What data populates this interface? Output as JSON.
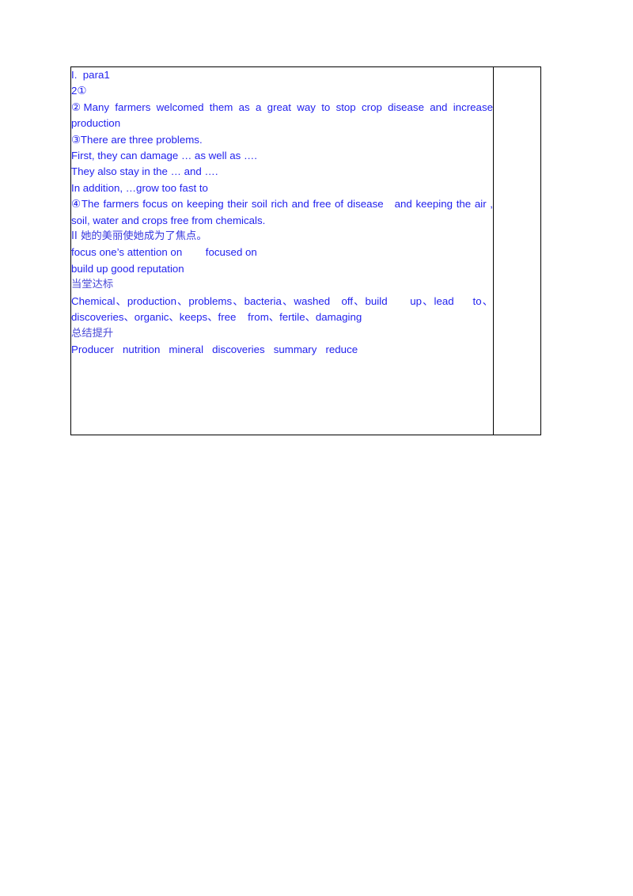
{
  "document": {
    "type": "worksheet",
    "text_color": "#2222ee",
    "border_color": "#000000",
    "background": "#ffffff"
  },
  "table": {
    "columns": 2,
    "main_cell": {
      "lines": [
        {
          "id": "l1",
          "text": "I.  para1"
        },
        {
          "id": "l2",
          "text": "2①"
        },
        {
          "id": "l3",
          "text": "②Many farmers welcomed them as a great way to stop crop disease and increase production"
        },
        {
          "id": "l4",
          "text": "③There are three problems."
        },
        {
          "id": "l5",
          "text": "First, they can damage … as well as …."
        },
        {
          "id": "l6",
          "text": "They also stay in the … and …."
        },
        {
          "id": "l7",
          "text": "In addition, …grow too fast to"
        },
        {
          "id": "l8",
          "text": "④The farmers focus on keeping their soil rich and free of disease   and keeping the air , soil, water and crops free from chemicals."
        },
        {
          "id": "l9",
          "text": "II 她的美丽使她成为了焦点。"
        },
        {
          "id": "l10",
          "text": "focus one’s attention on        focused on"
        },
        {
          "id": "l11",
          "text": "build up good reputation"
        },
        {
          "id": "l12",
          "text": "当堂达标"
        },
        {
          "id": "l13",
          "text": "Chemical、production、problems、bacteria、washed   off、build      up、lead     to、discoveries、organic、keeps、free    from、fertile、damaging"
        },
        {
          "id": "l14",
          "text": "总结提升"
        },
        {
          "id": "l15",
          "text": "Producer   nutrition   mineral   discoveries   summary   reduce"
        }
      ]
    },
    "side_cell": {
      "text": ""
    }
  }
}
